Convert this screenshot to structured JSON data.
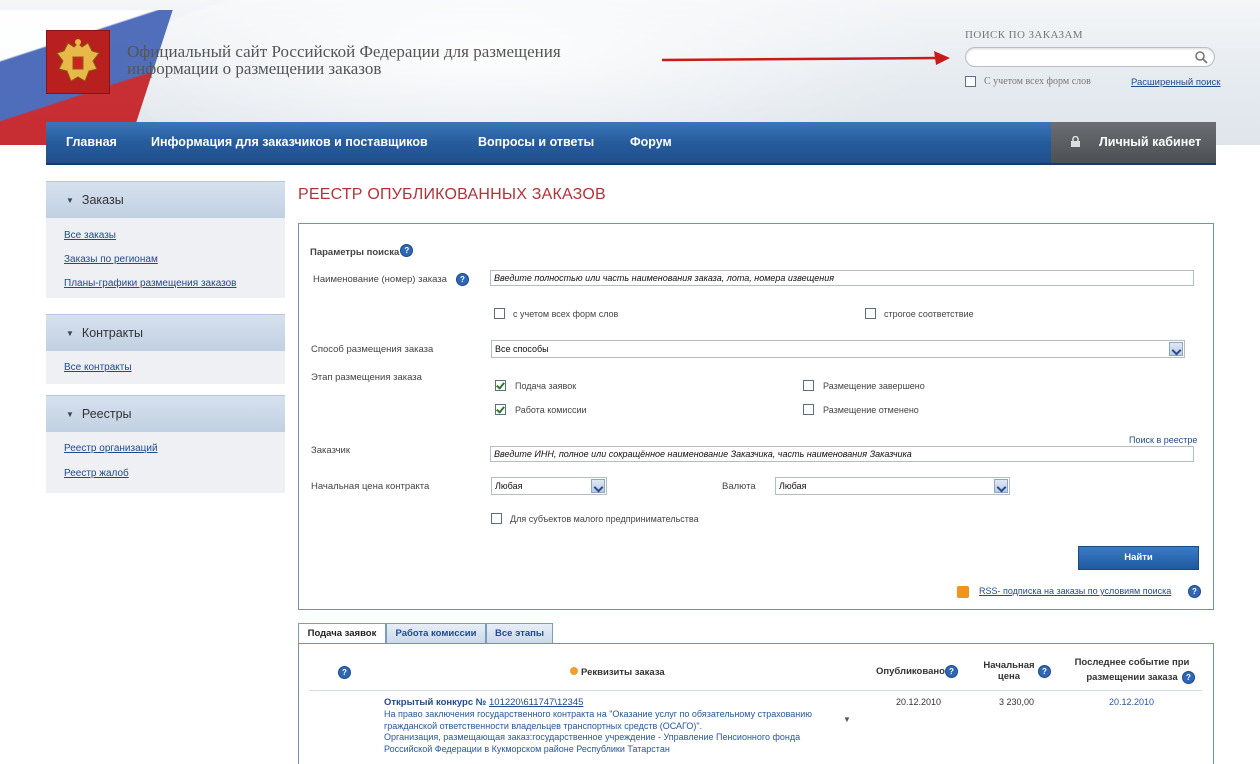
{
  "header": {
    "site_title_line1": "Официальный сайт Российской Федерации для размещения",
    "site_title_line2": "информации о размещении заказов",
    "search_label": "ПОИСК ПО ЗАКАЗАМ",
    "search_value": "",
    "all_forms_label": "С учетом всех форм слов",
    "advanced_search": "Расширенный поиск"
  },
  "nav": {
    "items": [
      "Главная",
      "Информация для заказчиков и поставщиков",
      "Вопросы и ответы",
      "Форум"
    ],
    "cabinet": "Личный кабинет"
  },
  "sidebar": [
    {
      "title": "Заказы",
      "links": [
        "Все заказы",
        "Заказы по регионам",
        "Планы-графики размещения заказов"
      ]
    },
    {
      "title": "Контракты",
      "links": [
        "Все контракты"
      ]
    },
    {
      "title": "Реестры",
      "links": [
        "Реестр организаций",
        "Реестр жалоб"
      ]
    }
  ],
  "main": {
    "title": "РЕЕСТР ОПУБЛИКОВАННЫХ ЗАКАЗОВ",
    "params_title": "Параметры поиска",
    "name_label": "Наименование (номер) заказа",
    "name_placeholder": "Введите полностью или часть наименования заказа, лота, номера извещения",
    "all_forms": "с учетом всех форм слов",
    "strict": "строгое соответствие",
    "method_label": "Способ размещения заказа",
    "method_value": "Все способы",
    "stage_label": "Этап размещения заказа",
    "stage_submit": "Подача заявок",
    "stage_commission": "Работа комиссии",
    "stage_done": "Размещение завершено",
    "stage_cancel": "Размещение отменено",
    "registry_search": "Поиск в реестре",
    "customer_label": "Заказчик",
    "customer_placeholder": "Введите ИНН, полное или сокращённое наименование Заказчика, часть наименования Заказчика",
    "price_label": "Начальная цена контракта",
    "price_value": "Любая",
    "currency_label": "Валюта",
    "currency_value": "Любая",
    "small_business": "Для субъектов малого предпринимательства",
    "find_button": "Найти",
    "rss": "RSS- подписка на заказы по условиям поиска"
  },
  "tabs": [
    "Подача заявок",
    "Работа комиссии",
    "Все этапы"
  ],
  "table": {
    "col_details": "Реквизиты заказа",
    "col_published": "Опубликовано",
    "col_price_1": "Начальная",
    "col_price_2": "цена",
    "col_last_1": "Последнее событие при",
    "col_last_2": "размещении заказа",
    "row": {
      "title_prefix": "Открытый конкурс №",
      "number": "101220\\611747\\12345",
      "desc_1": "На право заключения государственного контракта на \"Оказание услуг по обязательному страхованию",
      "desc_2": "гражданской ответственности владельцев транспортных средств (ОСАГО)\".",
      "desc_3": "Организация, размещающая заказ:государственное учреждение - Управление Пенсионного фонда",
      "desc_4": "Российской Федерации в Кукморском районе Республики Татарстан",
      "published": "20.12.2010",
      "price": "3 230,00",
      "last_event": "20.12.2010"
    }
  }
}
